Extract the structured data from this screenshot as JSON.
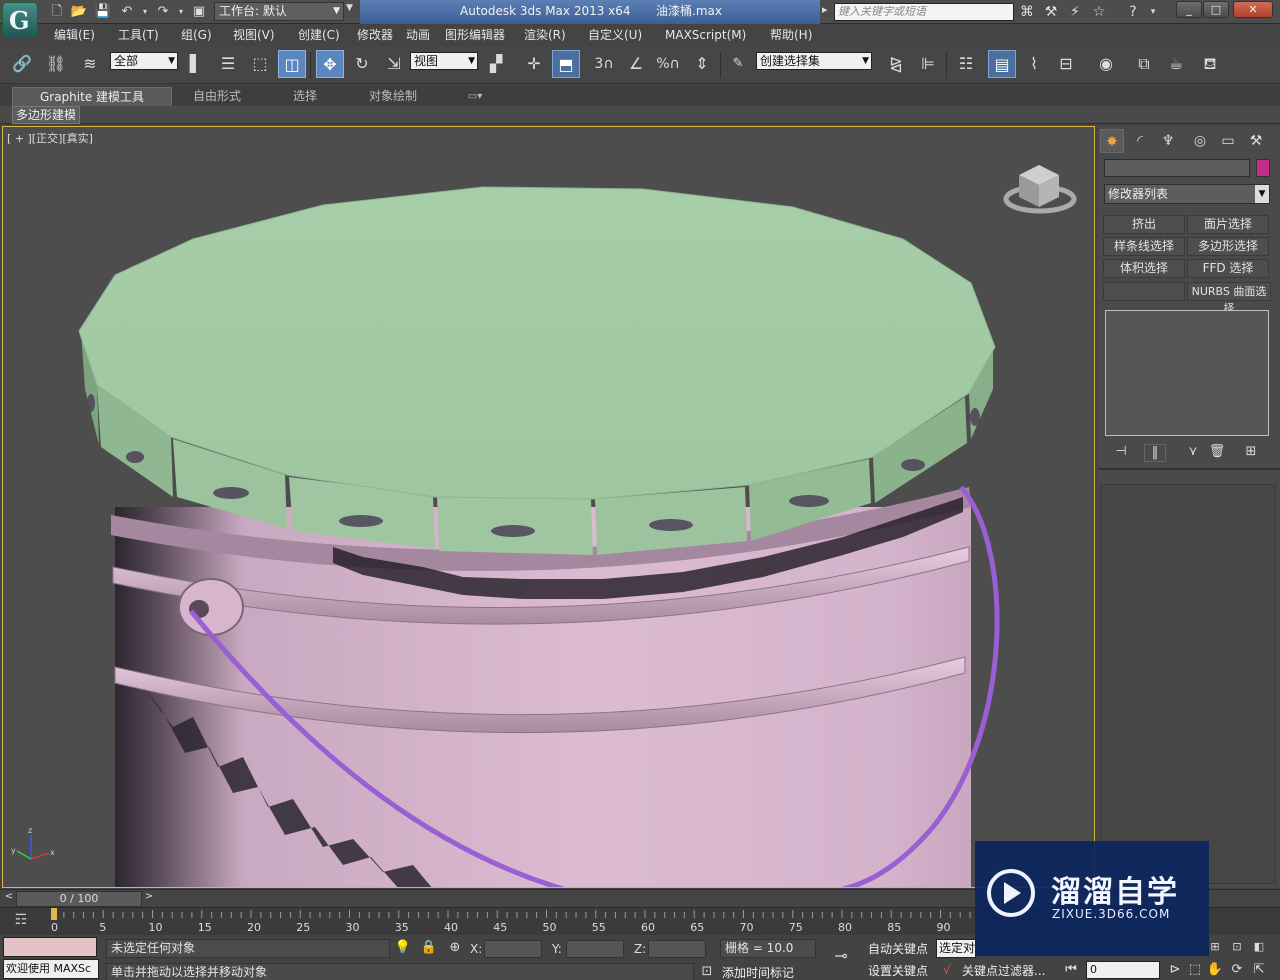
{
  "title": {
    "logo_glyph": "G",
    "workspace": "工作台: 默认",
    "app": "Autodesk 3ds Max  2013 x64",
    "file": "油漆桶.max",
    "search_placeholder": "键入关键字或短语",
    "minimize": "_",
    "restore": "□",
    "close": "✕"
  },
  "menus": [
    "编辑(E)",
    "工具(T)",
    "组(G)",
    "视图(V)",
    "创建(C)",
    "修改器",
    "动画",
    "图形编辑器",
    "渲染(R)",
    "自定义(U)",
    "MAXScript(M)",
    "帮助(H)"
  ],
  "toolbar": {
    "selection_filter": "全部",
    "ref_coord": "视图",
    "named_selection": "创建选择集"
  },
  "ribbon": {
    "tabs": [
      "Graphite 建模工具",
      "自由形式",
      "选择",
      "对象绘制"
    ],
    "sub_tab": "多边形建模"
  },
  "viewport": {
    "label_plus": "[ + ]",
    "label_view": "[正交]",
    "label_shading": "[真实]",
    "axis_labels": {
      "x": "x",
      "y": "y",
      "z": "z"
    }
  },
  "command_panel": {
    "modifier_list": "修改器列表",
    "buttons": [
      "挤出",
      "面片选择",
      "样条线选择",
      "多边形选择",
      "体积选择",
      "FFD 选择",
      "",
      "NURBS 曲面选择"
    ],
    "colors": {
      "object_color": "#c42e87"
    }
  },
  "timeline": {
    "slider": "0 / 100",
    "ticks": [
      "0",
      "5",
      "10",
      "15",
      "20",
      "25",
      "30",
      "35",
      "40",
      "45",
      "50",
      "55",
      "60",
      "65",
      "70",
      "75",
      "80",
      "85",
      "90"
    ]
  },
  "status": {
    "maxscript": "欢迎使用 MAXSc",
    "selection": "未选定任何对象",
    "prompt": "单击并拖动以选择并移动对象",
    "x_label": "X:",
    "y_label": "Y:",
    "z_label": "Z:",
    "grid": "栅格 = 10.0",
    "add_time_tag": "添加时间标记",
    "auto_key": "自动关键点",
    "set_key": "设置关键点",
    "selected": "选定对",
    "key_filter": "关键点过滤器...",
    "frame": "0"
  },
  "watermark": {
    "name": "溜溜自学",
    "url": "ZIXUE.3D66.COM"
  },
  "colors": {
    "lid": "#a7cda9",
    "bucket": "#d7b3cc",
    "handle": "#9a5fd2",
    "viewport_bg": "#4d4d4d",
    "accent": "#5b86bf"
  }
}
